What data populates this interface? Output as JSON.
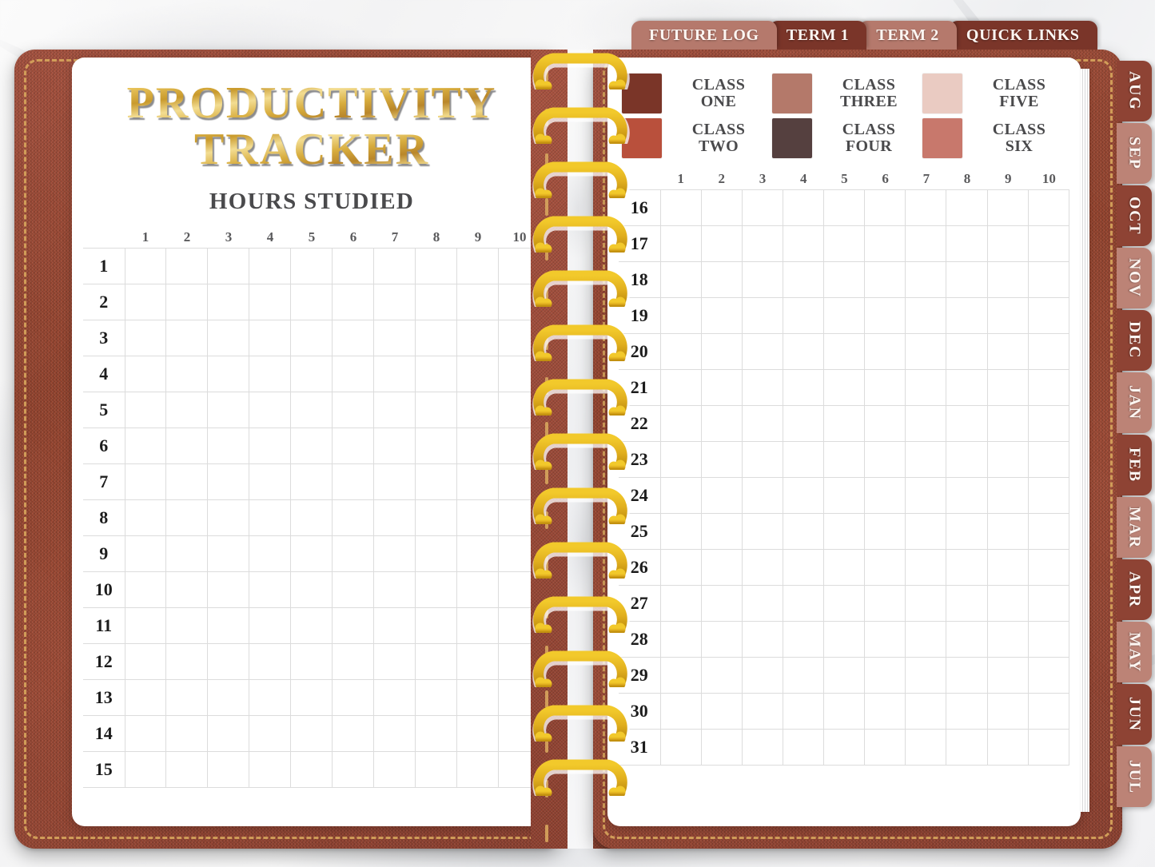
{
  "planner": {
    "left_page": {
      "title_line1": "PRODUCTIVITY",
      "title_line2": "TRACKER",
      "subtitle": "HOURS STUDIED",
      "column_headers": [
        "1",
        "2",
        "3",
        "4",
        "5",
        "6",
        "7",
        "8",
        "9",
        "10"
      ],
      "row_labels": [
        "1",
        "2",
        "3",
        "4",
        "5",
        "6",
        "7",
        "8",
        "9",
        "10",
        "11",
        "12",
        "13",
        "14",
        "15"
      ]
    },
    "right_page": {
      "column_headers": [
        "1",
        "2",
        "3",
        "4",
        "5",
        "6",
        "7",
        "8",
        "9",
        "10"
      ],
      "row_labels": [
        "16",
        "17",
        "18",
        "19",
        "20",
        "21",
        "22",
        "23",
        "24",
        "25",
        "26",
        "27",
        "28",
        "29",
        "30",
        "31"
      ],
      "legend": [
        {
          "label_line1": "CLASS",
          "label_line2": "ONE",
          "color": "#7A3528"
        },
        {
          "label_line1": "CLASS",
          "label_line2": "THREE",
          "color": "#B4796A"
        },
        {
          "label_line1": "CLASS",
          "label_line2": "FIVE",
          "color": "#EACBC2"
        },
        {
          "label_line1": "CLASS",
          "label_line2": "TWO",
          "color": "#B9503C"
        },
        {
          "label_line1": "CLASS",
          "label_line2": "FOUR",
          "color": "#55403F"
        },
        {
          "label_line1": "CLASS",
          "label_line2": "SIX",
          "color": "#C8786C"
        }
      ]
    },
    "top_tabs": [
      {
        "label": "FUTURE LOG",
        "color": "#B5796C"
      },
      {
        "label": "TERM 1",
        "color": "#7A3529"
      },
      {
        "label": "TERM 2",
        "color": "#B5796C"
      },
      {
        "label": "QUICK LINKS",
        "color": "#7A3529"
      }
    ],
    "month_tabs": [
      {
        "label": "AUG",
        "color": "#8E4334"
      },
      {
        "label": "SEP",
        "color": "#BC8376"
      },
      {
        "label": "OCT",
        "color": "#8E4334"
      },
      {
        "label": "NOV",
        "color": "#BC8376"
      },
      {
        "label": "DEC",
        "color": "#8E4334"
      },
      {
        "label": "JAN",
        "color": "#BC8376"
      },
      {
        "label": "FEB",
        "color": "#8E4334"
      },
      {
        "label": "MAR",
        "color": "#BC8376"
      },
      {
        "label": "APR",
        "color": "#8E4334"
      },
      {
        "label": "MAY",
        "color": "#BC8376"
      },
      {
        "label": "JUN",
        "color": "#8E4334"
      },
      {
        "label": "JUL",
        "color": "#BC8376"
      }
    ],
    "theme": {
      "cover_color": "#9E4936",
      "stitch_color": "#D6A45C",
      "spiral_color": "#E0AE1E",
      "grid_line_color": "#DCDCDC",
      "title_gold": "#D8AD3E",
      "text_dark": "#4A4A4C"
    },
    "spiral_ring_count": 14
  }
}
